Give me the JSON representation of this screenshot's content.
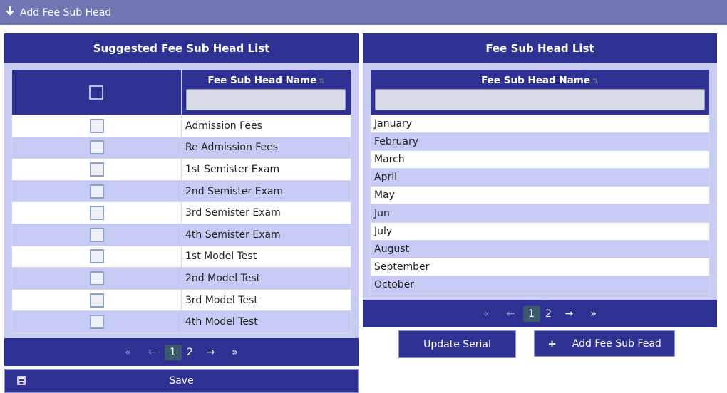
{
  "header": {
    "title": "Add Fee Sub Head",
    "icon": "arrow-down-icon"
  },
  "left_panel": {
    "title": "Suggested Fee Sub Head List",
    "column_header": "Fee Sub Head Name",
    "filter_placeholder": "",
    "rows": [
      {
        "name": "Admission Fees"
      },
      {
        "name": "Re Admission Fees"
      },
      {
        "name": "1st Semister Exam"
      },
      {
        "name": "2nd Semister Exam"
      },
      {
        "name": "3rd Semister Exam"
      },
      {
        "name": "4th Semister Exam"
      },
      {
        "name": "1st Model Test"
      },
      {
        "name": "2nd Model Test"
      },
      {
        "name": "3rd Model Test"
      },
      {
        "name": "4th Model Test"
      }
    ],
    "pager": {
      "pages": [
        "1",
        "2"
      ],
      "active": "1"
    },
    "save_label": "Save"
  },
  "right_panel": {
    "title": "Fee Sub Head List",
    "column_header": "Fee Sub Head Name",
    "filter_placeholder": "",
    "rows": [
      "January",
      "February",
      "March",
      "April",
      "May",
      "Jun",
      "July",
      "August",
      "September",
      "October"
    ],
    "pager": {
      "pages": [
        "1",
        "2"
      ],
      "active": "1"
    },
    "update_serial_label": "Update Serial",
    "add_label": "Add Fee Sub Fead"
  },
  "colors": {
    "primary": "#2f3192",
    "topbar": "#7275b4",
    "panel_bg": "#c8cbf2",
    "row_alt": "#c7caf5"
  }
}
